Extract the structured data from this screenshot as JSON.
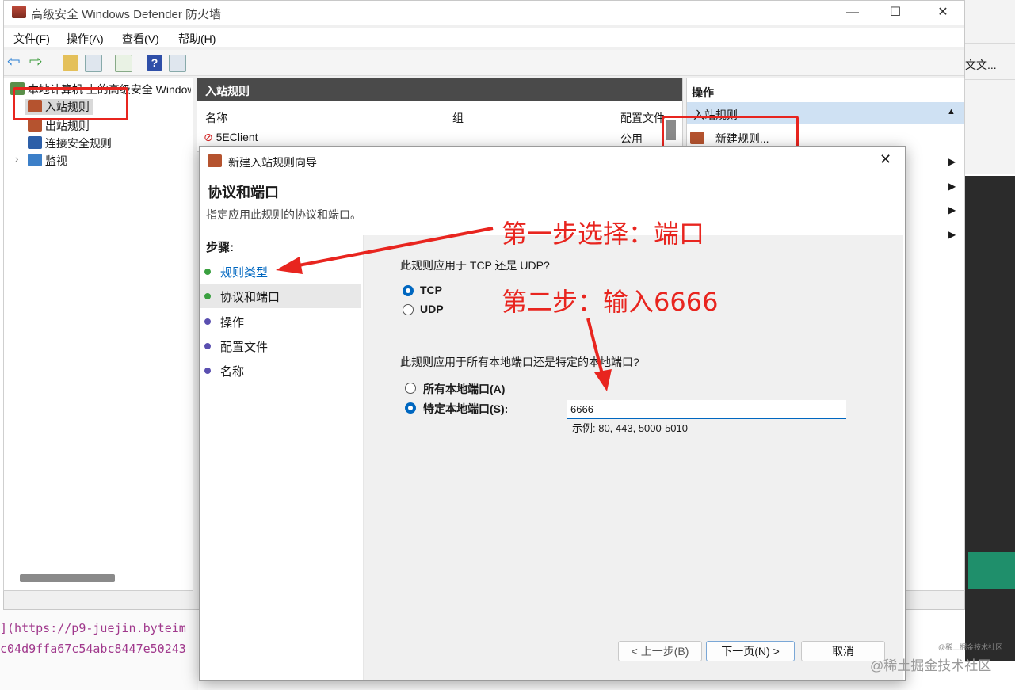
{
  "window": {
    "title": "高级安全 Windows Defender 防火墙",
    "minimize_glyph": "—",
    "maximize_glyph": "☐",
    "close_glyph": "✕"
  },
  "menu": [
    "文件(F)",
    "操作(A)",
    "查看(V)",
    "帮助(H)"
  ],
  "tree": {
    "root": "本地计算机 上的高级安全 Windows Defender 防火墙",
    "items": [
      {
        "label": "入站规则",
        "icon": "inbound-rules-icon"
      },
      {
        "label": "出站规则",
        "icon": "outbound-rules-icon"
      },
      {
        "label": "连接安全规则",
        "icon": "connection-security-icon"
      },
      {
        "label": "监视",
        "icon": "monitor-icon"
      }
    ],
    "expand_glyph": "›"
  },
  "list": {
    "header": "入站规则",
    "columns": [
      "名称",
      "组",
      "配置文件"
    ],
    "rows": [
      {
        "name": "5EClient",
        "group": "",
        "profile": "公用"
      }
    ]
  },
  "actions": {
    "header": "操作",
    "section": "入站规则",
    "new_rule": "新建规则..."
  },
  "dialog": {
    "title": "新建入站规则向导",
    "heading": "协议和端口",
    "subheading": "指定应用此规则的协议和端口。",
    "close_glyph": "✕",
    "steps_label": "步骤:",
    "steps": [
      "规则类型",
      "协议和端口",
      "操作",
      "配置文件",
      "名称"
    ],
    "q1": "此规则应用于 TCP 还是 UDP?",
    "protocol_options": [
      "TCP",
      "UDP"
    ],
    "q2": "此规则应用于所有本地端口还是特定的本地端口?",
    "port_options": [
      "所有本地端口(A)",
      "特定本地端口(S):"
    ],
    "port_value": "6666",
    "port_example": "示例: 80, 443, 5000-5010",
    "buttons": {
      "back": "< 上一步(B)",
      "next": "下一页(N) >",
      "cancel": "取消"
    }
  },
  "annotations": {
    "step1": "第一步选择：端口",
    "step2": "第二步：输入6666"
  },
  "background": {
    "code_line1": "](https://p9-juejin.byteim",
    "code_line2": "c04d9ffa67c54abc8447e50243",
    "right_fragment": "文文...",
    "watermark": "@稀土掘金技术社区",
    "small_watermark": "@稀土掘金技术社区"
  },
  "colors": {
    "annotation_red": "#e8251f",
    "accent_blue": "#0067c0",
    "list_header": "#4a4a4a"
  }
}
